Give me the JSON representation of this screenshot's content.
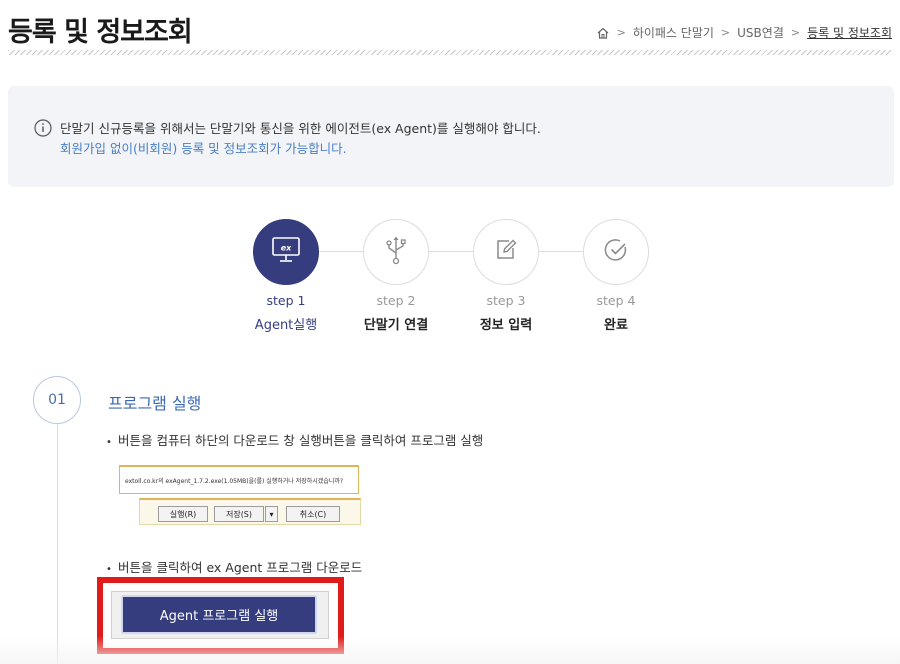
{
  "header": {
    "title": "등록 및 정보조회",
    "breadcrumb": [
      "하이패스 단말기",
      "USB연결",
      "등록 및 정보조회"
    ]
  },
  "notice": {
    "line1": "단말기 신규등록을 위해서는 단말기와 통신을 위한 에이전트(ex Agent)를 실행해야 합니다.",
    "line2": "회원가입 없이(비회원) 등록 및 정보조회가 가능합니다."
  },
  "steps": [
    {
      "num": "step 1",
      "label": "Agent실행",
      "icon": "monitor-ex-icon",
      "active": true
    },
    {
      "num": "step 2",
      "label": "단말기 연결",
      "icon": "usb-icon",
      "active": false
    },
    {
      "num": "step 3",
      "label": "정보 입력",
      "icon": "edit-icon",
      "active": false
    },
    {
      "num": "step 4",
      "label": "완료",
      "icon": "check-circle-icon",
      "active": false
    }
  ],
  "section": {
    "number": "01",
    "title": "프로그램 실행",
    "bullet1": "버튼을 컴퓨터 하단의 다운로드 창 실행버튼을 클릭하여 프로그램 실행",
    "download_bar": {
      "message": "extoll.co.kr의 exAgent_1.7.2.exe(1.05MB)을(를) 실행하거나 저장하시겠습니까?",
      "run": "실행(R)",
      "save": "저장(S)",
      "cancel": "취소(C)"
    },
    "bullet2": "버튼을 클릭하여 ex Agent 프로그램 다운로드",
    "agent_button": "Agent 프로그램 실행"
  },
  "colors": {
    "primary": "#353d7e",
    "link": "#4a7ec4",
    "highlight": "#e11a1a",
    "notice_bg": "#f2f4f7"
  }
}
